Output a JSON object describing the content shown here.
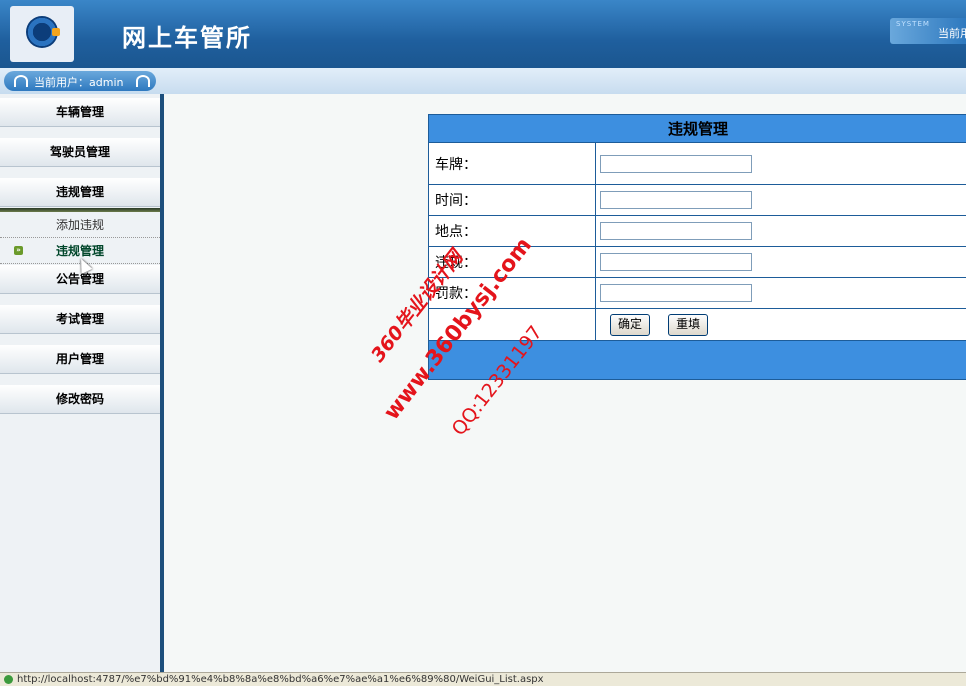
{
  "header": {
    "title": "网上车管所",
    "system_tag": "SYSTEM",
    "system_text": "当前用"
  },
  "userbar": {
    "text": "当前用户：admin"
  },
  "sidebar": {
    "items": [
      {
        "label": "车辆管理"
      },
      {
        "label": "驾驶员管理"
      },
      {
        "label": "违规管理"
      },
      {
        "label": "公告管理"
      },
      {
        "label": "考试管理"
      },
      {
        "label": "用户管理"
      },
      {
        "label": "修改密码"
      }
    ],
    "subitems": [
      {
        "label": "添加违规",
        "active": false
      },
      {
        "label": "违规管理",
        "active": true
      }
    ]
  },
  "form": {
    "title": "违规管理",
    "fields": [
      {
        "label": "车牌：",
        "value": ""
      },
      {
        "label": "时间：",
        "value": ""
      },
      {
        "label": "地点：",
        "value": ""
      },
      {
        "label": "违规：",
        "value": ""
      },
      {
        "label": "罚款：",
        "value": ""
      }
    ],
    "confirm_label": "确定",
    "reset_label": "重填"
  },
  "watermark": {
    "line1": "360毕业设计网",
    "line2": "www.360bysj.com",
    "line3": "QQ:12331197"
  },
  "statusbar": {
    "url": "http://localhost:4787/%e7%bd%91%e4%b8%8a%e8%bd%a6%e7%ae%a1%e6%89%80/WeiGui_List.aspx"
  },
  "colors": {
    "header_blue": "#1f5f9e",
    "table_header": "#3d8fe0",
    "watermark_red": "#e4141b",
    "active_menu": "#00462a"
  }
}
